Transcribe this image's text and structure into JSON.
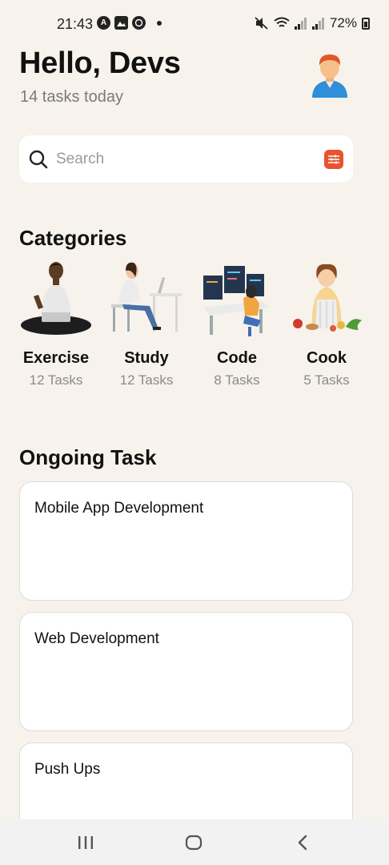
{
  "status_bar": {
    "time": "21:43",
    "battery": "72%",
    "icons": [
      "android-auto-icon",
      "gallery-icon",
      "whatsapp-icon",
      "dot-icon",
      "mute-icon",
      "wifi-icon",
      "signal-icon",
      "signal-icon",
      "battery-icon"
    ]
  },
  "header": {
    "greeting": "Hello, Devs",
    "subtitle": "14 tasks today"
  },
  "search": {
    "placeholder": "Search"
  },
  "categories": {
    "title": "Categories",
    "items": [
      {
        "name": "Exercise",
        "count": "12 Tasks"
      },
      {
        "name": "Study",
        "count": "12 Tasks"
      },
      {
        "name": "Code",
        "count": "8 Tasks"
      },
      {
        "name": "Cook",
        "count": "5 Tasks"
      }
    ]
  },
  "ongoing": {
    "title": "Ongoing Task",
    "tasks": [
      {
        "title": "Mobile App Development"
      },
      {
        "title": "Web Development"
      },
      {
        "title": "Push Ups"
      }
    ]
  },
  "colors": {
    "background": "#f7f3ec",
    "accent": "#e9532f",
    "card": "#ffffff"
  }
}
